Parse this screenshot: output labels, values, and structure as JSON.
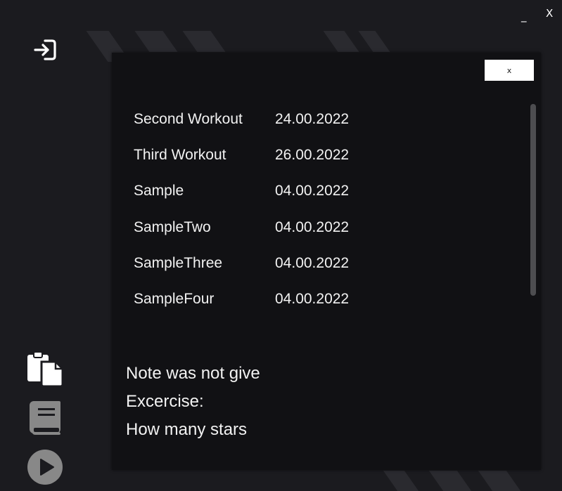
{
  "window": {
    "minimize_label": "_",
    "close_label": "X"
  },
  "sidebar": {
    "icons": [
      "login-icon",
      "clipboard-copy-icon",
      "book-icon",
      "play-icon"
    ]
  },
  "panel": {
    "close_label": "x",
    "workouts": [
      {
        "name": "Second Workout",
        "date": "24.00.2022"
      },
      {
        "name": "Third Workout",
        "date": "26.00.2022"
      },
      {
        "name": "Sample",
        "date": "04.00.2022"
      },
      {
        "name": "SampleTwo",
        "date": "04.00.2022"
      },
      {
        "name": "SampleThree",
        "date": "04.00.2022"
      },
      {
        "name": "SampleFour",
        "date": "04.00.2022"
      }
    ],
    "note": "Note was not give",
    "exercise_label": "Excercise:",
    "stars_label": "How many stars"
  },
  "colors": {
    "background": "#1b1b1f",
    "panel": "#111114",
    "text": "#f2f2f2",
    "scrollbar": "#4d4d50"
  }
}
